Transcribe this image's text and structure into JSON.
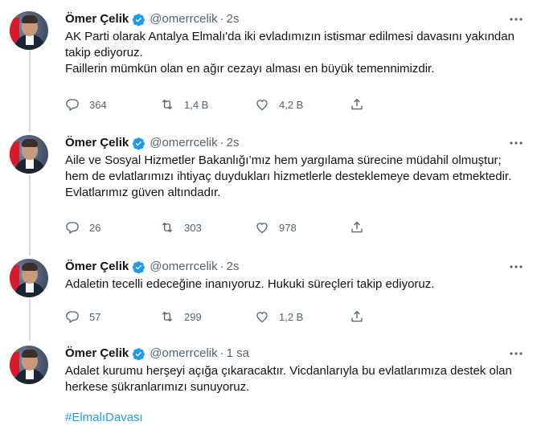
{
  "author": {
    "name": "Ömer Çelik",
    "handle": "@omerrcelik"
  },
  "separator": "·",
  "more_icon": "more-horizontal-icon",
  "verified_icon": "verified-badge-icon",
  "colors": {
    "verified": "#1d9bf0",
    "thread_line": "#cfd9de",
    "hashtag": "#1d9bf0",
    "muted": "#536471"
  },
  "tweets": [
    {
      "time": "2s",
      "text": "AK Parti olarak Antalya Elmalı'da iki evladımızın istismar edilmesi davasını yakından takip ediyoruz.\nFaillerin mümkün olan en ağır cezayı alması en büyük temennimizdir.",
      "replies": "364",
      "retweets": "1,4 B",
      "likes": "4,2 B"
    },
    {
      "time": "2s",
      "text": "Aile ve Sosyal Hizmetler Bakanlığı’mız hem yargılama sürecine müdahil olmuştur; hem de evlatlarımızı ihtiyaç duydukları hizmetlerle desteklemeye devam etmektedir. Evlatlarımız güven altındadır.",
      "replies": "26",
      "retweets": "303",
      "likes": "978"
    },
    {
      "time": "2s",
      "text": "Adaletin tecelli edeceğine inanıyoruz. Hukuki süreçleri takip ediyoruz.",
      "replies": "57",
      "retweets": "299",
      "likes": "1,2 B"
    },
    {
      "time": "1 sa",
      "text": "Adalet kurumu herşeyi açığa çıkaracaktır. Vicdanlarıyla bu evlatlarımıza destek olan herkese şükranlarımızı sunuyoruz.",
      "hashtag": "#ElmalıDavası"
    }
  ]
}
